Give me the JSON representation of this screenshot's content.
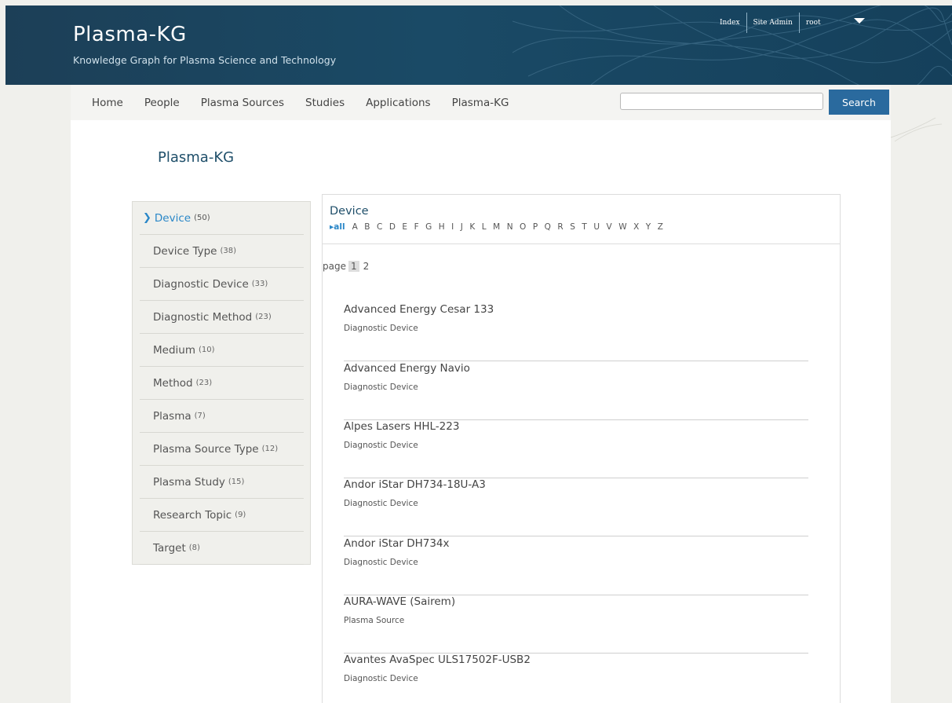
{
  "header": {
    "title": "Plasma-KG",
    "subtitle": "Knowledge Graph for Plasma Science and Technology",
    "top_links": [
      "Index",
      "Site Admin",
      "root"
    ]
  },
  "nav": {
    "items": [
      "Home",
      "People",
      "Plasma Sources",
      "Studies",
      "Applications",
      "Plasma-KG"
    ],
    "search_value": "",
    "search_label": "Search"
  },
  "page_title": "Plasma-KG",
  "sidebar": {
    "items": [
      {
        "label": "Device",
        "count": "(50)",
        "active": true
      },
      {
        "label": "Device Type",
        "count": "(38)"
      },
      {
        "label": "Diagnostic Device",
        "count": "(33)"
      },
      {
        "label": "Diagnostic Method",
        "count": "(23)"
      },
      {
        "label": "Medium",
        "count": "(10)"
      },
      {
        "label": "Method",
        "count": "(23)"
      },
      {
        "label": "Plasma",
        "count": "(7)"
      },
      {
        "label": "Plasma Source Type",
        "count": "(12)"
      },
      {
        "label": "Plasma Study",
        "count": "(15)"
      },
      {
        "label": "Research Topic",
        "count": "(9)"
      },
      {
        "label": "Target",
        "count": "(8)"
      }
    ]
  },
  "listing": {
    "title": "Device",
    "alpha_all": "all",
    "letters": [
      "A",
      "B",
      "C",
      "D",
      "E",
      "F",
      "G",
      "H",
      "I",
      "J",
      "K",
      "L",
      "M",
      "N",
      "O",
      "P",
      "Q",
      "R",
      "S",
      "T",
      "U",
      "V",
      "W",
      "X",
      "Y",
      "Z"
    ],
    "page_label": "page",
    "pages": [
      "1",
      "2"
    ],
    "devices": [
      {
        "name": "Advanced Energy Cesar 133",
        "type": "Diagnostic Device"
      },
      {
        "name": "Advanced Energy Navio",
        "type": "Diagnostic Device"
      },
      {
        "name": "Alpes Lasers HHL-223",
        "type": "Diagnostic Device"
      },
      {
        "name": "Andor iStar DH734-18U-A3",
        "type": "Diagnostic Device"
      },
      {
        "name": "Andor iStar DH734x",
        "type": "Diagnostic Device"
      },
      {
        "name": "AURA-WAVE (Sairem)",
        "type": "Plasma Source"
      },
      {
        "name": "Avantes AvaSpec ULS17502F-USB2",
        "type": "Diagnostic Device"
      }
    ]
  },
  "colors": {
    "header_bg": "#1c3f57",
    "accent": "#2a87c8",
    "search_button": "#2a6a9e"
  }
}
